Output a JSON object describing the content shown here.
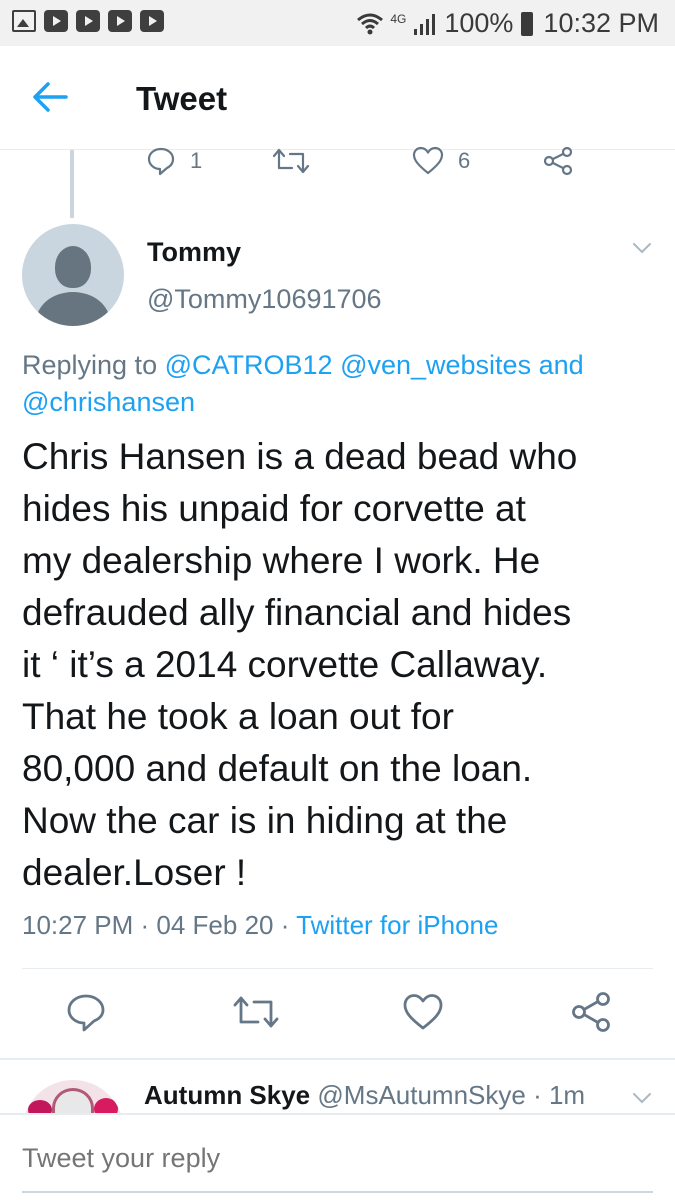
{
  "status_bar": {
    "battery": "100%",
    "time": "10:32 PM",
    "network": "4G"
  },
  "topbar": {
    "title": "Tweet"
  },
  "previous_tweet_actions": {
    "reply_count": "1",
    "like_count": "6"
  },
  "tweet": {
    "name": "Tommy",
    "handle": "@Tommy10691706",
    "replying_prefix": "Replying to ",
    "replying_mention_1": "@CATROB12",
    "replying_mention_2": "@ven_websites",
    "replying_and": " and",
    "replying_mention_3": "@chrishansen",
    "text": "Chris Hansen is a dead bead who\nhides his unpaid for corvette at\nmy dealership where I work.  He\ndefrauded ally financial  and hides\nit ‘ it’s a 2014 corvette Callaway.\nThat he took a loan out for\n80,000 and default on the loan.\nNow the car is in hiding at the\ndealer.Loser !",
    "time": "10:27 PM",
    "date": "04 Feb 20",
    "source": "Twitter for iPhone",
    "separator": " · "
  },
  "next_reply": {
    "name": "Autumn Skye",
    "handle": "@MsAutumnSkye",
    "age": "1m"
  },
  "compose": {
    "placeholder": "Tweet your reply"
  },
  "colors": {
    "accent": "#1da1f2",
    "secondary_text": "#657786",
    "primary_text": "#14171a",
    "divider": "#e6ecf0"
  }
}
